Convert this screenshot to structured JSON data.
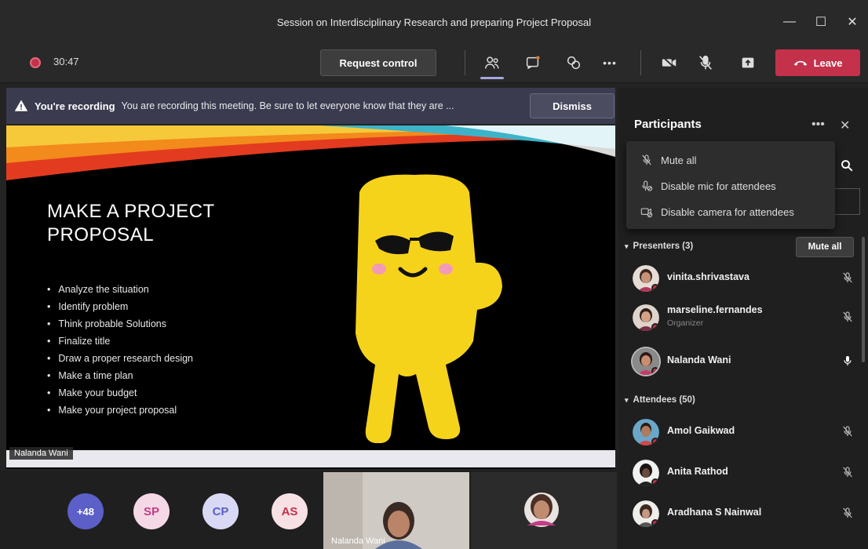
{
  "window": {
    "title": "Session on Interdisciplinary Research and preparing Project Proposal",
    "controls": [
      "—",
      "☐",
      "✕"
    ]
  },
  "toolbar": {
    "timer": "30:47",
    "request_control_label": "Request control",
    "more_label": "•••",
    "leave_label": "Leave"
  },
  "banner": {
    "strong": "You're recording",
    "message": "You are recording this meeting. Be sure to let everyone know that they are ...",
    "dismiss_label": "Dismiss"
  },
  "slide": {
    "title_line1": "MAKE A PROJECT",
    "title_line2": "PROPOSAL",
    "bullets": [
      "Analyze the situation",
      "Identify problem",
      "Think probable Solutions",
      "Finalize title",
      "Draw a proper research design",
      "Make a time plan",
      "Make your budget",
      "Make your project proposal"
    ],
    "presenter_tag": "Nalanda Wani"
  },
  "bottom": {
    "overflow_label": "+48",
    "avatars": [
      "SP",
      "CP",
      "AS"
    ],
    "video_name": "Nalanda Wani"
  },
  "panel": {
    "title": "Participants",
    "more_label": "•••",
    "close_label": "✕",
    "menu": [
      {
        "label": "Mute all",
        "icon": "mic-off-icon"
      },
      {
        "label": "Disable mic for attendees",
        "icon": "mic-disable-icon"
      },
      {
        "label": "Disable camera for attendees",
        "icon": "camera-disable-icon"
      }
    ],
    "presenters_header": "Presenters (3)",
    "mute_all_label": "Mute all",
    "presenters": [
      {
        "name": "vinita.shrivastava",
        "role": ""
      },
      {
        "name": "marseline.fernandes",
        "role": "Organizer"
      },
      {
        "name": "Nalanda Wani",
        "role": ""
      }
    ],
    "attendees_header": "Attendees (50)",
    "attendees": [
      {
        "name": "Amol Gaikwad"
      },
      {
        "name": "Anita Rathod"
      },
      {
        "name": "Aradhana S Nainwal"
      }
    ],
    "colors": {
      "accent": "#5b5fc7",
      "leave": "#c4314b",
      "banner": "#3a3b4f"
    }
  }
}
